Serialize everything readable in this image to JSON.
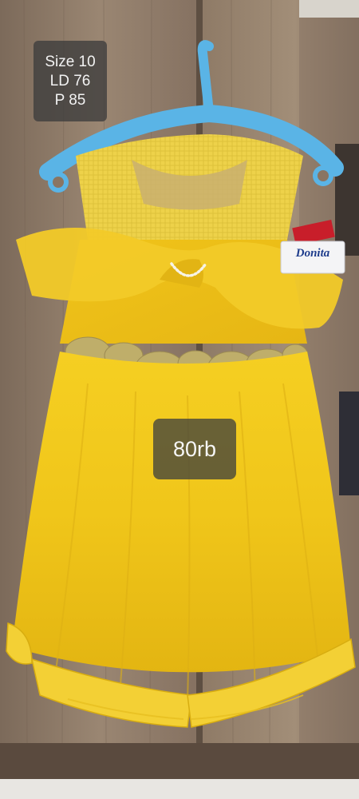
{
  "photo": {
    "subject": "dress-on-hanger-photo",
    "colors": {
      "dress": "#f2c91c",
      "hanger": "#5ab4e6",
      "wood": "#8a7562",
      "lace": "#bfae6a"
    }
  },
  "info_overlay": {
    "size": "Size 10",
    "ld": "LD 76",
    "p": "P 85"
  },
  "price_overlay": {
    "price": "80rb"
  },
  "brand_tag": {
    "label": "Donita"
  }
}
